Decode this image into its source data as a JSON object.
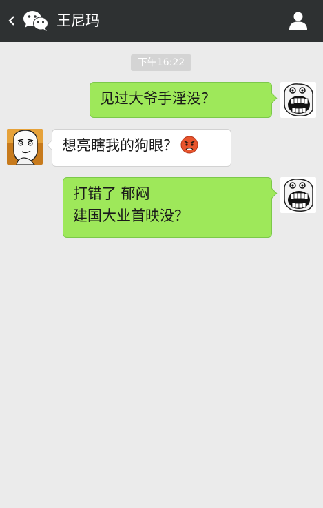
{
  "header": {
    "title": "王尼玛",
    "back_icon": "chevron-left-icon",
    "logo_icon": "wechat-logo-icon",
    "contact_icon": "person-icon",
    "background": "#2e3132"
  },
  "chat": {
    "timestamp": "下午16:22",
    "messages": [
      {
        "direction": "outgoing",
        "lines": [
          "见过大爷手淫没？"
        ],
        "avatar": "rage-face-laughing-avatar"
      },
      {
        "direction": "incoming",
        "lines": [
          "想亮瞎我的狗眼？"
        ],
        "emoji": "angry-face-emoji",
        "avatar": "rage-face-challenge-avatar"
      },
      {
        "direction": "outgoing",
        "lines": [
          "打错了  郁闷",
          "建国大业首映没？"
        ],
        "avatar": "rage-face-laughing-avatar"
      }
    ]
  },
  "colors": {
    "outgoing_bubble": "#9ee85a",
    "incoming_bubble": "#ffffff",
    "chat_background": "#ebebeb",
    "timestamp_background": "#d4d4d4"
  }
}
